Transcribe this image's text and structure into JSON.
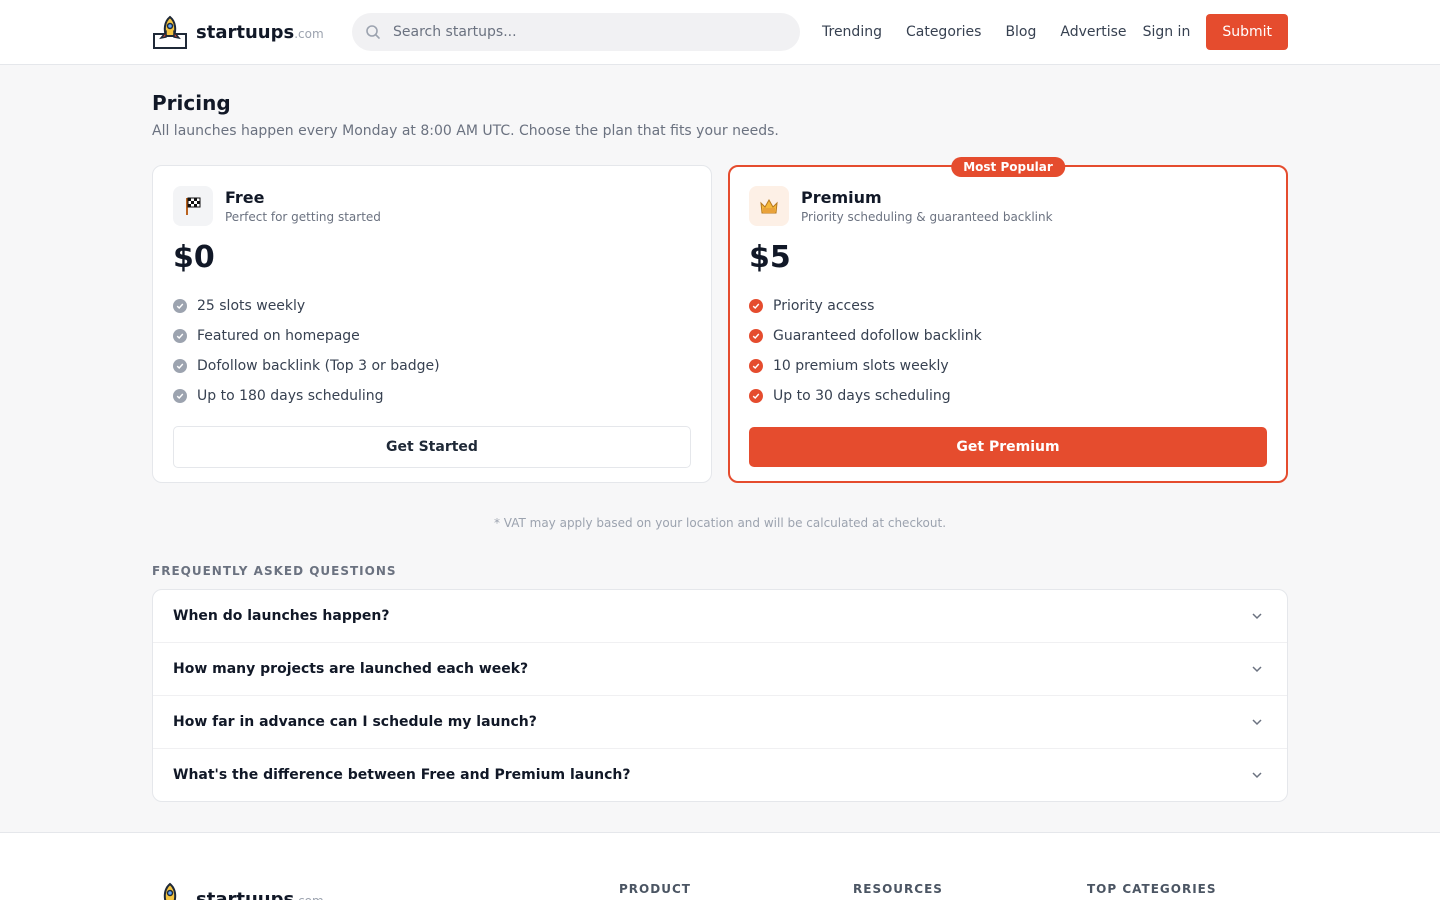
{
  "header": {
    "logo": {
      "name": "startuups",
      "tld": ".com"
    },
    "search_placeholder": "Search startups...",
    "nav": [
      "Trending",
      "Categories",
      "Blog",
      "Advertise"
    ],
    "signin": "Sign in",
    "submit": "Submit"
  },
  "pricing": {
    "title": "Pricing",
    "subtitle": "All launches happen every Monday at 8:00 AM UTC. Choose the plan that fits your needs.",
    "plans": [
      {
        "name": "Free",
        "desc": "Perfect for getting started",
        "price": "$0",
        "icon": "checkered-flag-icon",
        "features": [
          "25 slots weekly",
          "Featured on homepage",
          "Dofollow backlink (Top 3 or badge)",
          "Up to 180 days scheduling"
        ],
        "cta": "Get Started"
      },
      {
        "name": "Premium",
        "badge": "Most Popular",
        "desc": "Priority scheduling & guaranteed backlink",
        "price": "$5",
        "icon": "vip-crown-icon",
        "features": [
          "Priority access",
          "Guaranteed dofollow backlink",
          "10 premium slots weekly",
          "Up to 30 days scheduling"
        ],
        "cta": "Get Premium"
      }
    ],
    "vat_note": "* VAT may apply based on your location and will be calculated at checkout."
  },
  "faq": {
    "title": "FREQUENTLY ASKED QUESTIONS",
    "items": [
      "When do launches happen?",
      "How many projects are launched each week?",
      "How far in advance can I schedule my launch?",
      "What's the difference between Free and Premium launch?"
    ]
  },
  "footer": {
    "columns": [
      "PRODUCT",
      "RESOURCES",
      "TOP CATEGORIES"
    ]
  },
  "colors": {
    "accent": "#e54c2e",
    "muted": "#6b7280"
  }
}
